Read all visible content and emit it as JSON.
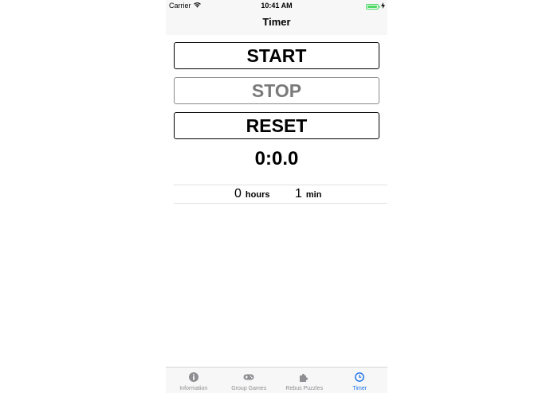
{
  "status_bar": {
    "carrier": "Carrier",
    "time": "10:41 AM",
    "battery_level": 1.0
  },
  "nav": {
    "title": "Timer"
  },
  "buttons": {
    "start_label": "START",
    "stop_label": "STOP",
    "reset_label": "RESET"
  },
  "timer": {
    "display": "0:0.0"
  },
  "picker": {
    "hours_value": "0",
    "hours_unit": "hours",
    "minutes_value": "1",
    "minutes_unit": "min"
  },
  "tabs": [
    {
      "label": "Information",
      "icon": "info-icon",
      "active": false
    },
    {
      "label": "Group Games",
      "icon": "gamepad-icon",
      "active": false
    },
    {
      "label": "Rebus Puzzles",
      "icon": "puzzle-icon",
      "active": false
    },
    {
      "label": "Timer",
      "icon": "clock-icon",
      "active": true
    }
  ],
  "colors": {
    "active_tab": "#1a73e8",
    "inactive_tab": "#8e8e93",
    "battery": "#4cd964",
    "bar_background": "#f7f7f7",
    "disabled_button": "#7a7a7a"
  }
}
